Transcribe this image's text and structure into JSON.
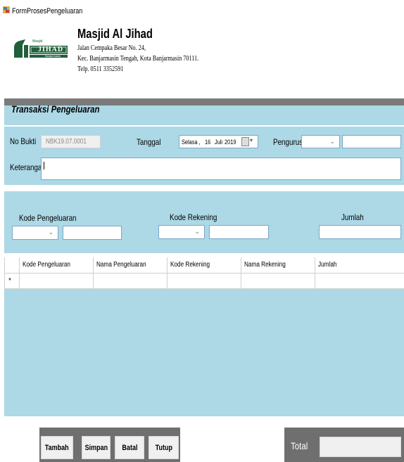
{
  "window": {
    "title": "FormProsesPengeluaran"
  },
  "header": {
    "org_name": "Masjid Al Jihad",
    "address_1": "Jalan Cempaka Besar No. 24,",
    "address_2": "Kec. Banjarmasin Tengah, Kota Banjarmasin 70111.",
    "phone": "Telp. 0511 3352591",
    "logo_top": "Masjid",
    "logo_main": "JIHAD",
    "logo_bottom": "Banjarmasin"
  },
  "section": {
    "title": "Transaksi Pengeluaran"
  },
  "form": {
    "no_bukti_label": "No Bukti",
    "no_bukti_value": "NBK19.07.0001",
    "tanggal_label": "Tanggal",
    "date_day": "Selasa ,",
    "date_date": "16",
    "date_month": "Juli",
    "date_year": "2019",
    "pengurus_label": "Pengurus",
    "pengurus_value": "",
    "keterangan_label": "Keterangan",
    "keterangan_value": ""
  },
  "inputs": {
    "kode_pengeluaran_label": "Kode Pengeluaran",
    "kode_rekening_label": "Kode Rekening",
    "jumlah_label": "Jumlah"
  },
  "grid": {
    "columns": [
      "Kode Pengeluaran",
      "Nama Pengeluaran",
      "Kode Rekening",
      "Nama Rekening",
      "Jumlah"
    ],
    "new_row_marker": "*"
  },
  "buttons": {
    "tambah": "Tambah",
    "simpan": "Simpan",
    "batal": "Batal",
    "tutup": "Tutup"
  },
  "total": {
    "label": "Total",
    "value": ""
  },
  "colors": {
    "panel": "#add8e6",
    "dark_panel": "#6f6f6f",
    "logo_green": "#1f5f3a"
  }
}
